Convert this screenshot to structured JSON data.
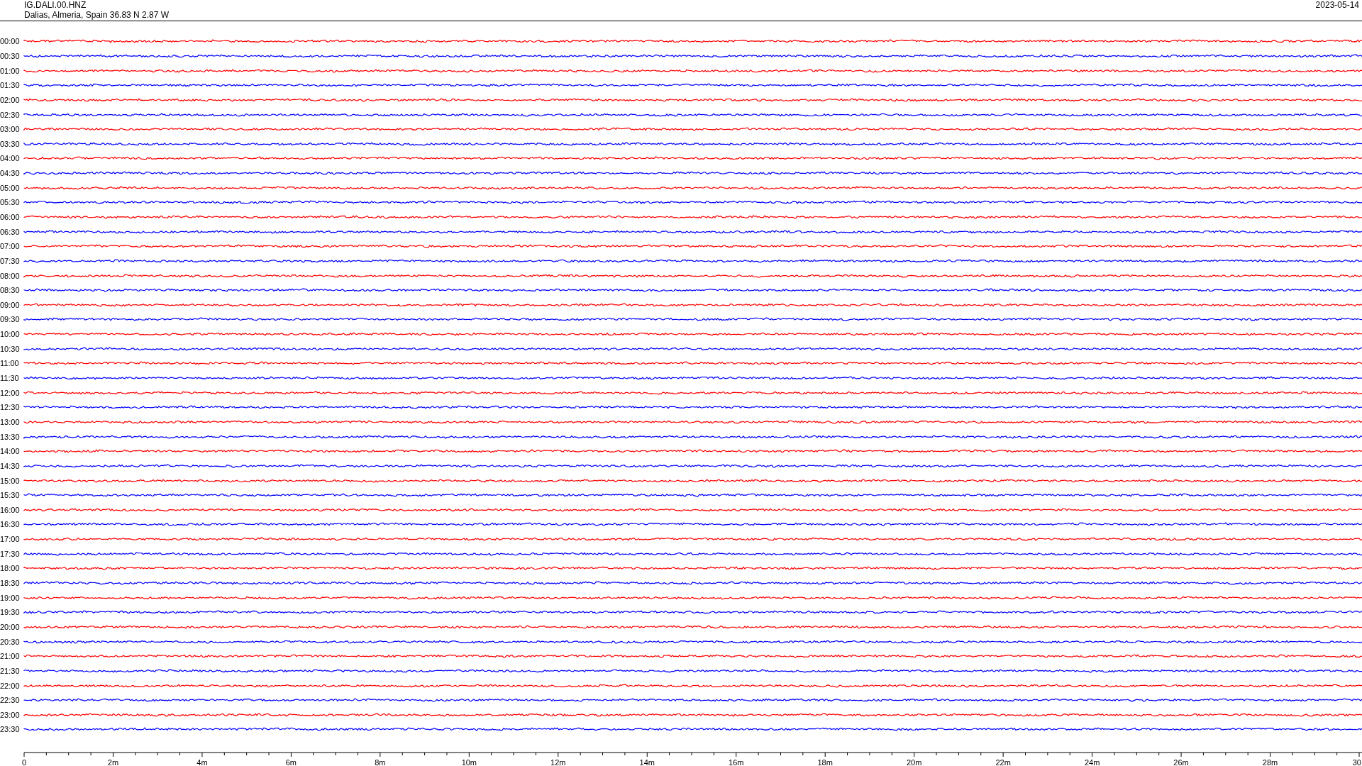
{
  "header": {
    "station": "IG.DALI.00.HNZ",
    "location": "Dalias, Almeria, Spain  36.83 N 2.87 W",
    "date": "2023-05-14"
  },
  "rows": [
    {
      "time": "00:00",
      "color": "#ff0000"
    },
    {
      "time": "00:30",
      "color": "#0000ff"
    },
    {
      "time": "01:00",
      "color": "#ff0000"
    },
    {
      "time": "01:30",
      "color": "#0000ff"
    },
    {
      "time": "02:00",
      "color": "#ff0000"
    },
    {
      "time": "02:30",
      "color": "#0000ff"
    },
    {
      "time": "03:00",
      "color": "#ff0000"
    },
    {
      "time": "03:30",
      "color": "#0000ff"
    },
    {
      "time": "04:00",
      "color": "#ff0000"
    },
    {
      "time": "04:30",
      "color": "#0000ff"
    },
    {
      "time": "05:00",
      "color": "#ff0000"
    },
    {
      "time": "05:30",
      "color": "#0000ff"
    },
    {
      "time": "06:00",
      "color": "#ff0000"
    },
    {
      "time": "06:30",
      "color": "#0000ff"
    },
    {
      "time": "07:00",
      "color": "#ff0000"
    },
    {
      "time": "07:30",
      "color": "#0000ff"
    },
    {
      "time": "08:00",
      "color": "#ff0000"
    },
    {
      "time": "08:30",
      "color": "#0000ff"
    },
    {
      "time": "09:00",
      "color": "#ff0000"
    },
    {
      "time": "09:30",
      "color": "#0000ff"
    },
    {
      "time": "10:00",
      "color": "#ff0000"
    },
    {
      "time": "10:30",
      "color": "#0000ff"
    },
    {
      "time": "11:00",
      "color": "#ff0000"
    },
    {
      "time": "11:30",
      "color": "#0000ff"
    },
    {
      "time": "12:00",
      "color": "#ff0000"
    },
    {
      "time": "12:30",
      "color": "#0000ff"
    },
    {
      "time": "13:00",
      "color": "#ff0000"
    },
    {
      "time": "13:30",
      "color": "#0000ff"
    },
    {
      "time": "14:00",
      "color": "#ff0000"
    },
    {
      "time": "14:30",
      "color": "#0000ff"
    },
    {
      "time": "15:00",
      "color": "#ff0000"
    },
    {
      "time": "15:30",
      "color": "#0000ff"
    },
    {
      "time": "16:00",
      "color": "#ff0000"
    },
    {
      "time": "16:30",
      "color": "#0000ff"
    },
    {
      "time": "17:00",
      "color": "#ff0000"
    },
    {
      "time": "17:30",
      "color": "#0000ff"
    },
    {
      "time": "18:00",
      "color": "#ff0000"
    },
    {
      "time": "18:30",
      "color": "#0000ff"
    },
    {
      "time": "19:00",
      "color": "#ff0000"
    },
    {
      "time": "19:30",
      "color": "#0000ff"
    },
    {
      "time": "20:00",
      "color": "#ff0000"
    },
    {
      "time": "20:30",
      "color": "#0000ff"
    },
    {
      "time": "21:00",
      "color": "#ff0000"
    },
    {
      "time": "21:30",
      "color": "#0000ff"
    },
    {
      "time": "22:00",
      "color": "#ff0000"
    },
    {
      "time": "22:30",
      "color": "#0000ff"
    },
    {
      "time": "23:00",
      "color": "#ff0000"
    },
    {
      "time": "23:30",
      "color": "#0000ff"
    }
  ],
  "x_axis": {
    "tick_labels": [
      "0",
      "2m",
      "4m",
      "6m",
      "8m",
      "10m",
      "12m",
      "14m",
      "16m",
      "18m",
      "20m",
      "22m",
      "24m",
      "26m",
      "28m",
      "30"
    ]
  }
}
